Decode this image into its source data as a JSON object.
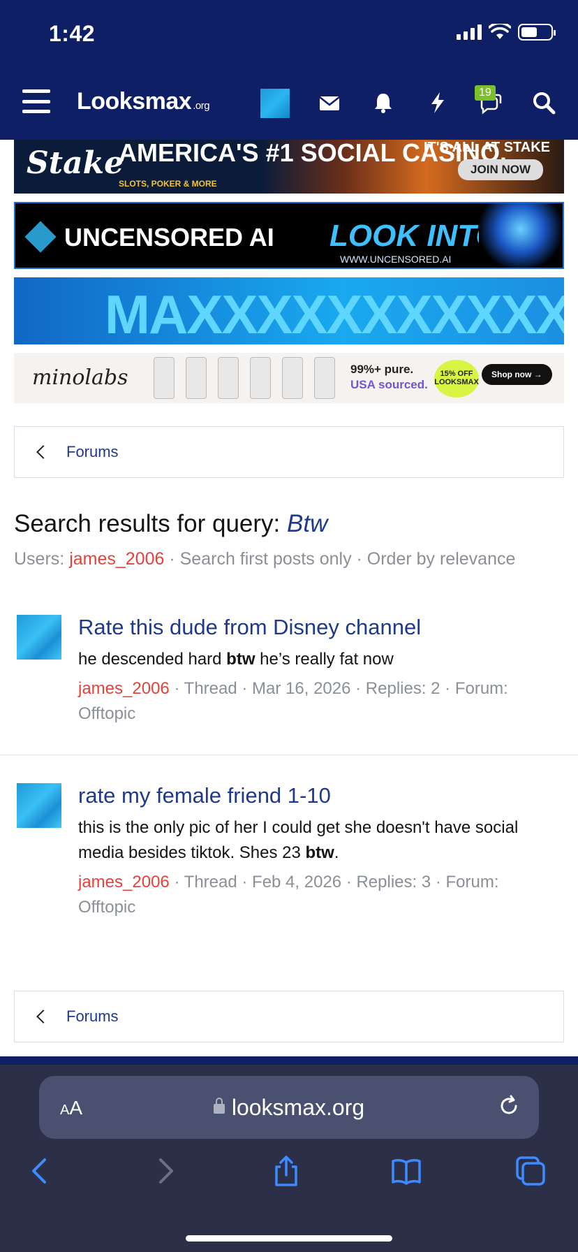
{
  "status": {
    "time": "1:42"
  },
  "nav": {
    "logo": "Looksmax",
    "logo_suffix": ".org",
    "alerts_badge": "19"
  },
  "ads": {
    "stake": {
      "brand": "Stake",
      "headline": "AMERICA'S #1 SOCIAL CASINO.",
      "subline": "SLOTS, POKER & MORE",
      "tag": "IT'S ALL AT STAKE",
      "cta": "JOIN NOW"
    },
    "uncensored": {
      "brand": "UNCENSORED AI",
      "headline": "LOOK INTO IT",
      "url": "WWW.UNCENSORED.AI"
    },
    "maxx": {
      "text": "MAXXXXXXXXXXXXX"
    },
    "minolabs": {
      "brand": "minolabs",
      "line1": "99%+ pure.",
      "line2": "USA sourced.",
      "discount": "15% OFF LOOKSMAX",
      "cta": "Shop now →"
    }
  },
  "breadcrumb": {
    "label": "Forums"
  },
  "search": {
    "title_prefix": "Search results for query:",
    "query": "Btw",
    "sub_prefix": "Users:",
    "sub_user": "james_2006",
    "sub_rest": "· Search first posts only · Order by relevance"
  },
  "results": [
    {
      "title": "Rate this dude from Disney channel",
      "snippet_before": "he descended hard",
      "snippet_bold": "btw",
      "snippet_after": "he’s really fat now",
      "author": "james_2006",
      "meta": "· Thread · Mar 16, 2026 · Replies: 2 · Forum: Offtopic"
    },
    {
      "title": "rate my female friend 1-10",
      "snippet_before": "this is the only pic of her I could get she doesn't have social media besides tiktok. Shes 23",
      "snippet_bold": "btw",
      "snippet_after": ".",
      "author": "james_2006",
      "meta": "· Thread · Feb 4, 2026 · Replies: 3 · Forum: Offtopic"
    }
  ],
  "safari": {
    "aa_big": "A",
    "aa_small": "A",
    "url": "looksmax.org"
  }
}
